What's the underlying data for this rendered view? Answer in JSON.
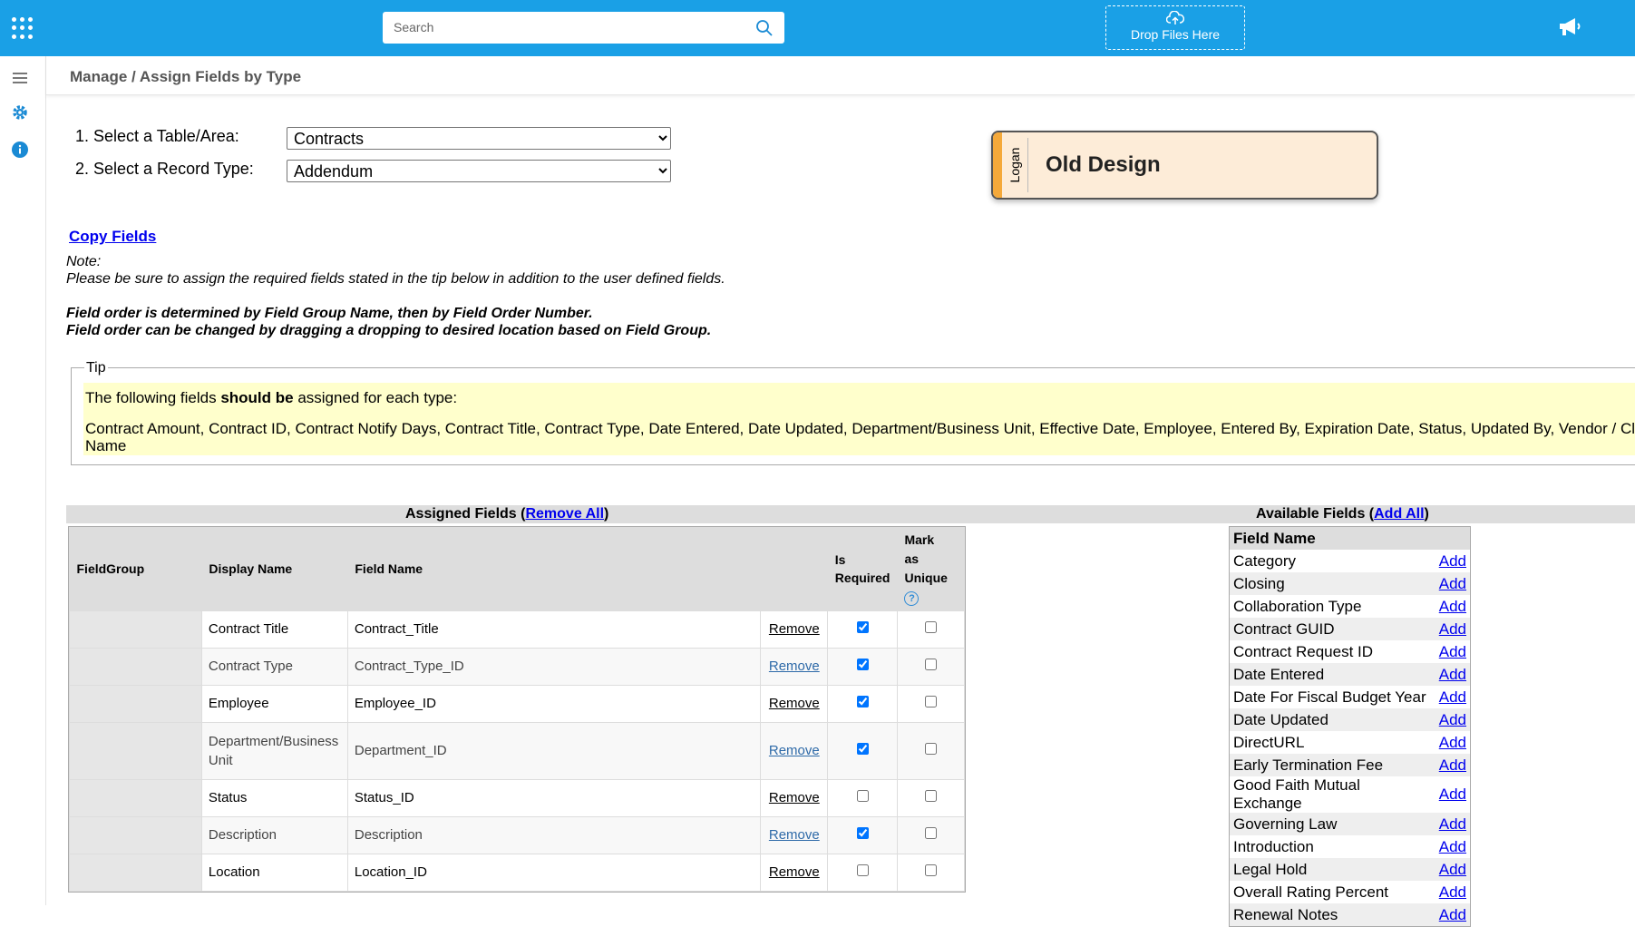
{
  "header": {
    "search_placeholder": "Search",
    "drop_label": "Drop Files Here",
    "icons": [
      "apps-grid-icon",
      "search-icon",
      "upload-cloud-icon",
      "megaphone-icon"
    ]
  },
  "sidebar": {
    "icons": [
      "menu-icon",
      "gear-icon",
      "info-icon"
    ]
  },
  "breadcrumb": "Manage / Assign Fields by Type",
  "form": {
    "table_label": "1. Select a Table/Area:",
    "table_value": "Contracts",
    "type_label": "2. Select a Record Type:",
    "type_value": "Addendum"
  },
  "design_card": {
    "user": "Logan",
    "title": "Old Design"
  },
  "copy_fields": "Copy Fields",
  "note": {
    "label": "Note:",
    "line1": "Please be sure to assign the required fields stated in the tip below in addition to the user defined fields.",
    "bold1": "Field order is determined by Field Group Name, then by Field Order Number.",
    "bold2": "Field order can be changed by dragging a dropping to desired location based on Field Group."
  },
  "tip": {
    "legend": "Tip",
    "line1_pre": "The following fields ",
    "line1_bold": "should be",
    "line1_post": " assigned for each type:",
    "fields": "Contract Amount, Contract ID, Contract Notify Days, Contract Title, Contract Type, Date Entered, Date Updated, Department/Business Unit, Effective Date, Employee, Entered By, Expiration Date, Status, Updated By, Vendor / Cli",
    "fields_line2": "Name"
  },
  "assigned": {
    "heading": "Assigned Fields (",
    "remove_all": "Remove All",
    "close": ")",
    "columns": {
      "fieldgroup": "FieldGroup",
      "display": "Display Name",
      "field": "Field Name",
      "required_1": "Is",
      "required_2": "Required",
      "unique_1": "Mark",
      "unique_2": "as",
      "unique_3": "Unique",
      "help": "?"
    },
    "remove_label": "Remove",
    "rows": [
      {
        "group": "",
        "display": "Contract Title",
        "field": "Contract_Title",
        "required": true,
        "unique": false
      },
      {
        "group": "",
        "display": "Contract Type",
        "field": "Contract_Type_ID",
        "required": true,
        "unique": false
      },
      {
        "group": "",
        "display": "Employee",
        "field": "Employee_ID",
        "required": true,
        "unique": false
      },
      {
        "group": "",
        "display": "Department/Business Unit",
        "field": "Department_ID",
        "required": true,
        "unique": false
      },
      {
        "group": "",
        "display": "Status",
        "field": "Status_ID",
        "required": false,
        "unique": false
      },
      {
        "group": "",
        "display": "Description",
        "field": "Description",
        "required": true,
        "unique": false
      },
      {
        "group": "",
        "display": "Location",
        "field": "Location_ID",
        "required": false,
        "unique": false
      }
    ]
  },
  "available": {
    "heading": "Available Fields (",
    "add_all": "Add All",
    "close": ")",
    "column": "Field Name",
    "add_label": "Add",
    "rows": [
      "Category",
      "Closing",
      "Collaboration Type",
      "Contract GUID",
      "Contract Request ID",
      "Date Entered",
      "Date For Fiscal Budget Year",
      "Date Updated",
      "DirectURL",
      "Early Termination Fee",
      "Good Faith Mutual Exchange",
      "Governing Law",
      "Introduction",
      "Legal Hold",
      "Overall Rating Percent",
      "Renewal Notes"
    ]
  }
}
